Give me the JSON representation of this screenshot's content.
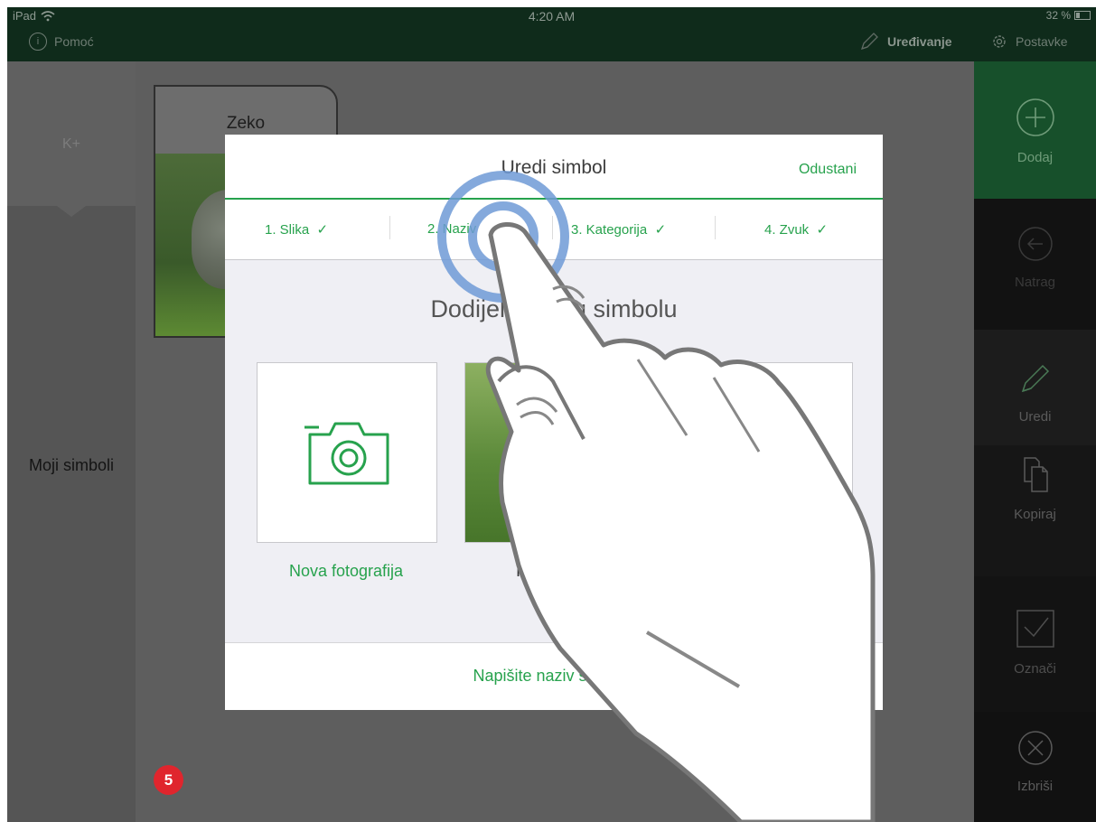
{
  "status_bar": {
    "device": "iPad",
    "time": "4:20 AM",
    "battery": "32 %",
    "battery_level": 0.32
  },
  "top_bar": {
    "help_label": "Pomoć",
    "edit_label": "Uređivanje",
    "settings_label": "Postavke"
  },
  "sidebar": {
    "top_item": "K+",
    "section_label": "Moji simboli"
  },
  "card": {
    "name": "Zeko"
  },
  "right_toolbar": {
    "add": "Dodaj",
    "back": "Natrag",
    "edit": "Uredi",
    "copy": "Kopiraj",
    "select": "Označi",
    "delete": "Izbriši"
  },
  "step_badge": "5",
  "modal": {
    "title": "Uredi simbol",
    "cancel": "Odustani",
    "steps": [
      "1. Slika",
      "2. Naziv",
      "3. Kategorija",
      "4. Zvuk"
    ],
    "check": "✓",
    "heading": "Dodijelite sliku simbolu",
    "new_photo": "Nova fotografija",
    "from_album": "Iz albuma",
    "footer": "Napišite naziv simbola"
  },
  "colors": {
    "accent": "#27a24d",
    "status_bar": "#0f2b1b",
    "badge": "#e0252d",
    "tap_ring": "#6f9ad6"
  },
  "icons": [
    "wifi-icon",
    "info-icon",
    "pencil-icon",
    "gear-icon",
    "plus-circle-icon",
    "back-arrow-icon",
    "copy-icon",
    "checkbox-icon",
    "x-circle-icon",
    "camera-icon",
    "arrow-right-icon",
    "tap-ring-icon",
    "pointing-hand"
  ]
}
